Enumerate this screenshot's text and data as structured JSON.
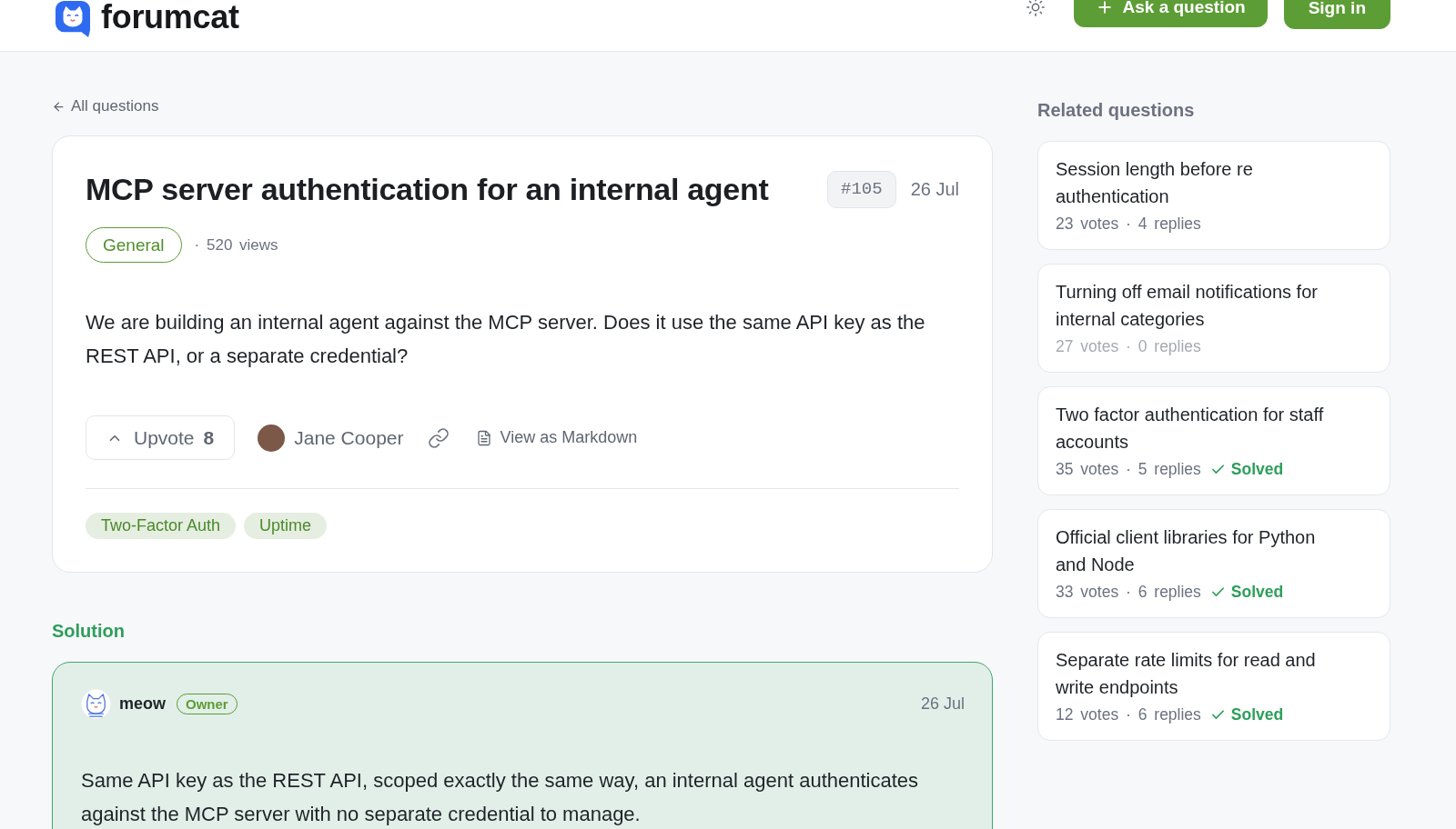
{
  "header": {
    "logo": "forumcat",
    "buttons": [
      {
        "label": "Ask a question",
        "kind": "add"
      },
      {
        "label": "Sign in",
        "kind": "plain"
      }
    ]
  },
  "back_link": "All questions",
  "question": {
    "title": "MCP server authentication for an internal agent",
    "number": "#105",
    "date": "26 Jul",
    "category": "General",
    "views": "· 520 views",
    "body": "We are building an internal agent against the MCP server. Does it use the same API key as the REST API, or a separate credential?",
    "upvote": {
      "label": "Upvote",
      "count": "8"
    },
    "author": "Jane Cooper",
    "markdown_link": "View as Markdown",
    "tags": [
      "Two-Factor Auth",
      "Uptime"
    ]
  },
  "solution": {
    "heading": "Solution",
    "author": "meow",
    "role": "Owner",
    "date": "26 Jul",
    "body": "Same API key as the REST API, scoped exactly the same way, an internal agent authenticates against the MCP server with no separate credential to manage."
  },
  "related": {
    "heading": "Related questions",
    "items": [
      {
        "title": "Session length before re authentication",
        "meta": "23 votes · 4 replies",
        "dimmed": false
      },
      {
        "title": "Turning off email notifications for internal categories",
        "meta": "27 votes · 0 replies",
        "dimmed": true
      },
      {
        "title": "Two factor authentication for staff accounts",
        "meta": "35 votes · 5 replies",
        "dimmed": false,
        "status": "Solved"
      },
      {
        "title": "Official client libraries for Python and Node",
        "meta": "33 votes · 6 replies",
        "dimmed": false,
        "status": "Solved"
      },
      {
        "title": "Separate rate limits for read and write endpoints",
        "meta": "12 votes · 6 replies",
        "dimmed": false,
        "status": "Solved"
      }
    ]
  }
}
